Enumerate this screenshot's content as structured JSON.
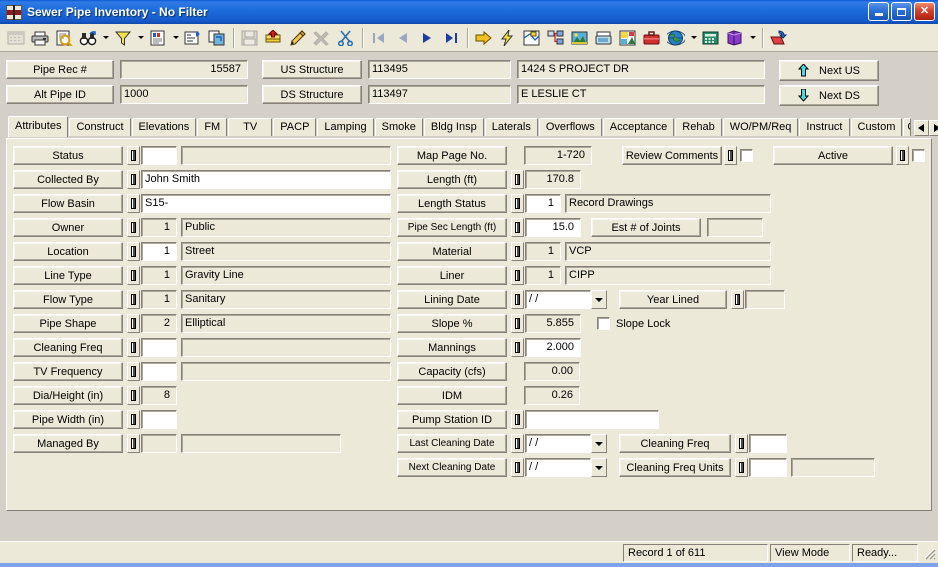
{
  "window": {
    "title": "Sewer Pipe Inventory - No Filter",
    "minimize_label": "Minimize",
    "maximize_label": "Maximize",
    "close_label": "✕"
  },
  "toolbar": {
    "groups": [
      {
        "items": [
          {
            "name": "datasheet-view-icon",
            "label": "Datasheet View",
            "disabled": true
          },
          {
            "name": "print-icon",
            "label": "Print",
            "disabled": false
          },
          {
            "name": "print-preview-icon",
            "label": "Print Preview",
            "disabled": false
          },
          {
            "name": "find-binoculars-icon",
            "label": "Find",
            "disabled": false,
            "dropdown": true
          },
          {
            "name": "filter-funnel-icon",
            "label": "Filter",
            "disabled": false,
            "dropdown": true
          },
          {
            "name": "report-icon",
            "label": "Reports",
            "disabled": false,
            "dropdown": true
          },
          {
            "name": "form-design-icon",
            "label": "Form Design",
            "disabled": false
          },
          {
            "name": "relationships-icon",
            "label": "Relationships",
            "disabled": false
          }
        ]
      },
      {
        "items": [
          {
            "name": "save-record-icon",
            "label": "Save",
            "disabled": true
          },
          {
            "name": "add-record-icon",
            "label": "Add Record",
            "disabled": false
          },
          {
            "name": "edit-record-icon",
            "label": "Edit Record",
            "disabled": false
          },
          {
            "name": "delete-record-icon",
            "label": "Delete Record",
            "disabled": true
          },
          {
            "name": "cut-scissors-icon",
            "label": "Cut",
            "disabled": false
          }
        ]
      },
      {
        "items": [
          {
            "name": "first-record-icon",
            "label": "First Record",
            "disabled": true
          },
          {
            "name": "previous-record-icon",
            "label": "Previous Record",
            "disabled": true
          },
          {
            "name": "next-record-icon",
            "label": "Next Record",
            "disabled": false
          },
          {
            "name": "last-record-icon",
            "label": "Last Record",
            "disabled": false
          }
        ]
      },
      {
        "items": [
          {
            "name": "goto-arrow-icon",
            "label": "Go To",
            "disabled": false
          },
          {
            "name": "lightning-icon",
            "label": "Quick Action",
            "disabled": false
          },
          {
            "name": "map-icon",
            "label": "Map",
            "disabled": false
          },
          {
            "name": "hierarchy-icon",
            "label": "Hierarchy",
            "disabled": false
          },
          {
            "name": "image-icon",
            "label": "Images",
            "disabled": false
          },
          {
            "name": "fax-icon",
            "label": "Fax",
            "disabled": false
          },
          {
            "name": "photo-icon",
            "label": "Photos",
            "disabled": false
          },
          {
            "name": "toolbox-icon",
            "label": "Tools",
            "disabled": false
          },
          {
            "name": "globe-icon",
            "label": "Web",
            "disabled": false,
            "dropdown": true
          },
          {
            "name": "calculator-icon",
            "label": "Calculator",
            "disabled": false
          },
          {
            "name": "help-book-icon",
            "label": "Help",
            "disabled": false,
            "dropdown": true
          }
        ]
      },
      {
        "items": [
          {
            "name": "exit-icon",
            "label": "Exit",
            "disabled": false
          }
        ]
      }
    ]
  },
  "header": {
    "pipe_rec_label": "Pipe Rec #",
    "pipe_rec_value": "15587",
    "alt_pipe_id_label": "Alt Pipe ID",
    "alt_pipe_id_value": "1000",
    "us_structure_label": "US Structure",
    "us_structure_value": "113495",
    "us_street_value": "1424  S  PROJECT DR",
    "ds_structure_label": "DS Structure",
    "ds_structure_value": "113497",
    "ds_street_value": " E  LESLIE CT",
    "next_us_label": "Next US",
    "next_ds_label": "Next DS"
  },
  "tabs": {
    "items": [
      {
        "label": "Attributes",
        "active": true
      },
      {
        "label": "Construct",
        "active": false
      },
      {
        "label": "Elevations",
        "active": false
      },
      {
        "label": "FM",
        "active": false
      },
      {
        "label": "TV",
        "active": false
      },
      {
        "label": "PACP",
        "active": false
      },
      {
        "label": "Lamping",
        "active": false
      },
      {
        "label": "Smoke",
        "active": false
      },
      {
        "label": "Bldg Insp",
        "active": false
      },
      {
        "label": "Laterals",
        "active": false
      },
      {
        "label": "Overflows",
        "active": false
      },
      {
        "label": "Acceptance",
        "active": false
      },
      {
        "label": "Rehab",
        "active": false
      },
      {
        "label": "WO/PM/Req",
        "active": false
      },
      {
        "label": "Instruct",
        "active": false
      },
      {
        "label": "Custom",
        "active": false
      },
      {
        "label": "Co",
        "active": false
      }
    ],
    "scroll_left": "◀",
    "scroll_right": "▶"
  },
  "left_column": [
    {
      "label": "Status",
      "code": "",
      "desc": "",
      "code_editable": true,
      "has_desc": true
    },
    {
      "label": "Collected By",
      "code": null,
      "desc": "John Smith",
      "code_editable": false,
      "has_desc": true,
      "wide_edit": true
    },
    {
      "label": "Flow Basin",
      "code": null,
      "desc": "S15-",
      "code_editable": false,
      "has_desc": true,
      "wide_edit": true
    },
    {
      "label": "Owner",
      "code": "1",
      "desc": "Public",
      "code_editable": false,
      "has_desc": true
    },
    {
      "label": "Location",
      "code": "1",
      "desc": "Street",
      "code_editable": true,
      "has_desc": true
    },
    {
      "label": "Line Type",
      "code": "1",
      "desc": "Gravity Line",
      "code_editable": false,
      "has_desc": true
    },
    {
      "label": "Flow Type",
      "code": "1",
      "desc": "Sanitary",
      "code_editable": false,
      "has_desc": true
    },
    {
      "label": "Pipe Shape",
      "code": "2",
      "desc": "Elliptical",
      "code_editable": false,
      "has_desc": true
    },
    {
      "label": "Cleaning Freq",
      "code": "",
      "desc": "",
      "code_editable": true,
      "has_desc": true
    },
    {
      "label": "TV Frequency",
      "code": "",
      "desc": "",
      "code_editable": true,
      "has_desc": true
    },
    {
      "label": "Dia/Height (in)",
      "code": "8",
      "desc": null,
      "code_editable": false,
      "has_desc": false
    },
    {
      "label": "Pipe Width (in)",
      "code": "",
      "desc": null,
      "code_editable": true,
      "has_desc": false
    },
    {
      "label": "Managed By",
      "code": "",
      "desc": "",
      "code_editable": false,
      "has_desc": true,
      "narrow_desc": true
    }
  ],
  "mid_column": {
    "map_page_label": "Map Page No.",
    "map_page_value": "1-720",
    "length_label": "Length (ft)",
    "length_value": "170.8",
    "length_status_label": "Length Status",
    "length_status_code": "1",
    "length_status_desc": "Record Drawings",
    "pipe_sec_length_label": "Pipe Sec Length (ft)",
    "pipe_sec_length_value": "15.0",
    "est_joints_label": "Est # of Joints",
    "est_joints_value": "",
    "material_label": "Material",
    "material_code": "1",
    "material_desc": "VCP",
    "liner_label": "Liner",
    "liner_code": "1",
    "liner_desc": "CIPP",
    "lining_date_label": "Lining Date",
    "lining_date_value": " /  /",
    "year_lined_label": "Year Lined",
    "year_lined_value": "",
    "slope_label": "Slope %",
    "slope_value": "5.855",
    "slope_lock_label": "Slope Lock",
    "mannings_label": "Mannings",
    "mannings_value": "2.000",
    "capacity_label": "Capacity (cfs)",
    "capacity_value": "0.00",
    "idm_label": "IDM",
    "idm_value": "0.26",
    "pump_station_label": "Pump Station ID",
    "pump_station_value": "",
    "last_cleaning_label": "Last Cleaning Date",
    "last_cleaning_value": " /  /",
    "next_cleaning_label": "Next Cleaning Date",
    "next_cleaning_value": " /  /",
    "cleaning_freq_label": "Cleaning Freq",
    "cleaning_freq_value": "",
    "cleaning_freq_units_label": "Cleaning Freq Units",
    "cleaning_freq_units_code": "",
    "cleaning_freq_units_desc": ""
  },
  "right_column": {
    "review_comments_label": "Review Comments",
    "active_label": "Active"
  },
  "statusbar": {
    "record_text": "Record 1 of 611",
    "mode_text": "View Mode",
    "ready_text": "Ready..."
  }
}
